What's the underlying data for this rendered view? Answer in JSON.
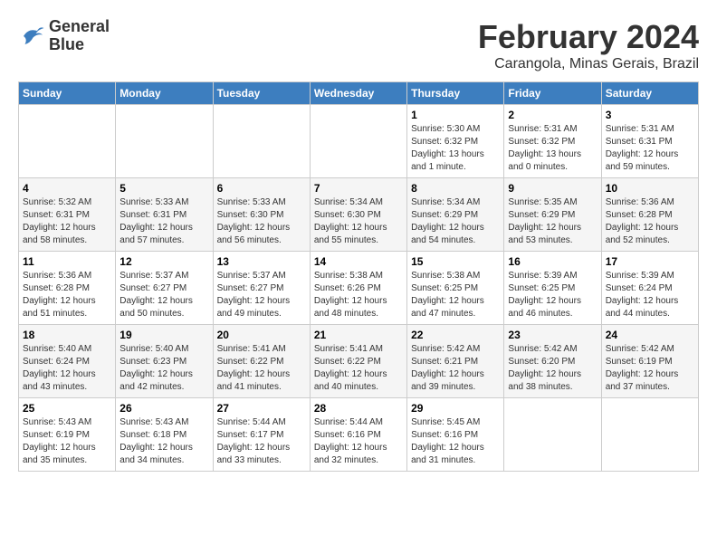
{
  "logo": {
    "line1": "General",
    "line2": "Blue"
  },
  "title": "February 2024",
  "subtitle": "Carangola, Minas Gerais, Brazil",
  "weekdays": [
    "Sunday",
    "Monday",
    "Tuesday",
    "Wednesday",
    "Thursday",
    "Friday",
    "Saturday"
  ],
  "weeks": [
    [
      {
        "day": "",
        "info": ""
      },
      {
        "day": "",
        "info": ""
      },
      {
        "day": "",
        "info": ""
      },
      {
        "day": "",
        "info": ""
      },
      {
        "day": "1",
        "info": "Sunrise: 5:30 AM\nSunset: 6:32 PM\nDaylight: 13 hours\nand 1 minute."
      },
      {
        "day": "2",
        "info": "Sunrise: 5:31 AM\nSunset: 6:32 PM\nDaylight: 13 hours\nand 0 minutes."
      },
      {
        "day": "3",
        "info": "Sunrise: 5:31 AM\nSunset: 6:31 PM\nDaylight: 12 hours\nand 59 minutes."
      }
    ],
    [
      {
        "day": "4",
        "info": "Sunrise: 5:32 AM\nSunset: 6:31 PM\nDaylight: 12 hours\nand 58 minutes."
      },
      {
        "day": "5",
        "info": "Sunrise: 5:33 AM\nSunset: 6:31 PM\nDaylight: 12 hours\nand 57 minutes."
      },
      {
        "day": "6",
        "info": "Sunrise: 5:33 AM\nSunset: 6:30 PM\nDaylight: 12 hours\nand 56 minutes."
      },
      {
        "day": "7",
        "info": "Sunrise: 5:34 AM\nSunset: 6:30 PM\nDaylight: 12 hours\nand 55 minutes."
      },
      {
        "day": "8",
        "info": "Sunrise: 5:34 AM\nSunset: 6:29 PM\nDaylight: 12 hours\nand 54 minutes."
      },
      {
        "day": "9",
        "info": "Sunrise: 5:35 AM\nSunset: 6:29 PM\nDaylight: 12 hours\nand 53 minutes."
      },
      {
        "day": "10",
        "info": "Sunrise: 5:36 AM\nSunset: 6:28 PM\nDaylight: 12 hours\nand 52 minutes."
      }
    ],
    [
      {
        "day": "11",
        "info": "Sunrise: 5:36 AM\nSunset: 6:28 PM\nDaylight: 12 hours\nand 51 minutes."
      },
      {
        "day": "12",
        "info": "Sunrise: 5:37 AM\nSunset: 6:27 PM\nDaylight: 12 hours\nand 50 minutes."
      },
      {
        "day": "13",
        "info": "Sunrise: 5:37 AM\nSunset: 6:27 PM\nDaylight: 12 hours\nand 49 minutes."
      },
      {
        "day": "14",
        "info": "Sunrise: 5:38 AM\nSunset: 6:26 PM\nDaylight: 12 hours\nand 48 minutes."
      },
      {
        "day": "15",
        "info": "Sunrise: 5:38 AM\nSunset: 6:25 PM\nDaylight: 12 hours\nand 47 minutes."
      },
      {
        "day": "16",
        "info": "Sunrise: 5:39 AM\nSunset: 6:25 PM\nDaylight: 12 hours\nand 46 minutes."
      },
      {
        "day": "17",
        "info": "Sunrise: 5:39 AM\nSunset: 6:24 PM\nDaylight: 12 hours\nand 44 minutes."
      }
    ],
    [
      {
        "day": "18",
        "info": "Sunrise: 5:40 AM\nSunset: 6:24 PM\nDaylight: 12 hours\nand 43 minutes."
      },
      {
        "day": "19",
        "info": "Sunrise: 5:40 AM\nSunset: 6:23 PM\nDaylight: 12 hours\nand 42 minutes."
      },
      {
        "day": "20",
        "info": "Sunrise: 5:41 AM\nSunset: 6:22 PM\nDaylight: 12 hours\nand 41 minutes."
      },
      {
        "day": "21",
        "info": "Sunrise: 5:41 AM\nSunset: 6:22 PM\nDaylight: 12 hours\nand 40 minutes."
      },
      {
        "day": "22",
        "info": "Sunrise: 5:42 AM\nSunset: 6:21 PM\nDaylight: 12 hours\nand 39 minutes."
      },
      {
        "day": "23",
        "info": "Sunrise: 5:42 AM\nSunset: 6:20 PM\nDaylight: 12 hours\nand 38 minutes."
      },
      {
        "day": "24",
        "info": "Sunrise: 5:42 AM\nSunset: 6:19 PM\nDaylight: 12 hours\nand 37 minutes."
      }
    ],
    [
      {
        "day": "25",
        "info": "Sunrise: 5:43 AM\nSunset: 6:19 PM\nDaylight: 12 hours\nand 35 minutes."
      },
      {
        "day": "26",
        "info": "Sunrise: 5:43 AM\nSunset: 6:18 PM\nDaylight: 12 hours\nand 34 minutes."
      },
      {
        "day": "27",
        "info": "Sunrise: 5:44 AM\nSunset: 6:17 PM\nDaylight: 12 hours\nand 33 minutes."
      },
      {
        "day": "28",
        "info": "Sunrise: 5:44 AM\nSunset: 6:16 PM\nDaylight: 12 hours\nand 32 minutes."
      },
      {
        "day": "29",
        "info": "Sunrise: 5:45 AM\nSunset: 6:16 PM\nDaylight: 12 hours\nand 31 minutes."
      },
      {
        "day": "",
        "info": ""
      },
      {
        "day": "",
        "info": ""
      }
    ]
  ]
}
